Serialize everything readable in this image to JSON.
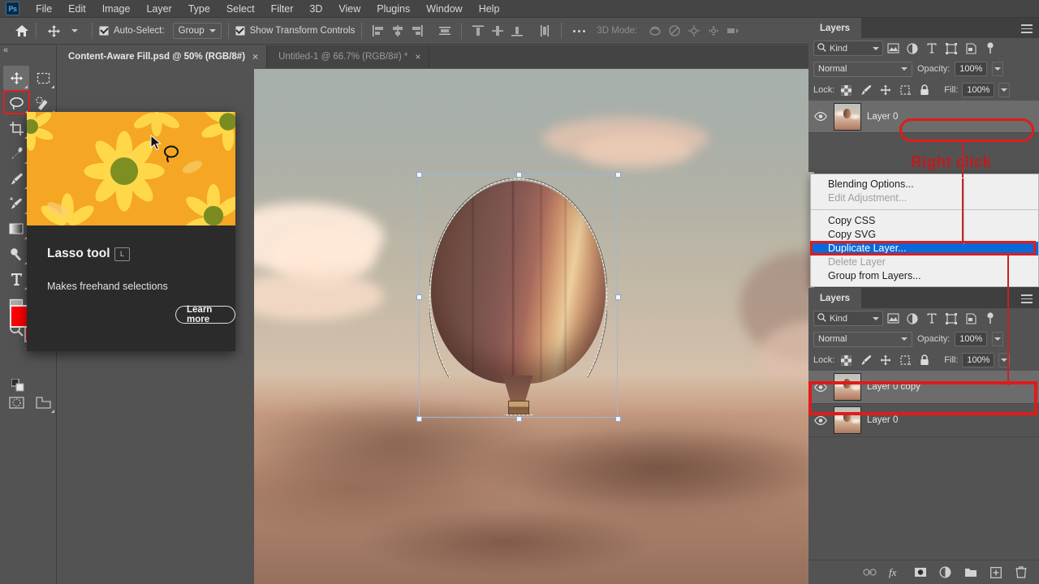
{
  "app": {
    "name": "Adobe Photoshop",
    "logo_text": "Ps"
  },
  "menubar": {
    "items": [
      "File",
      "Edit",
      "Image",
      "Layer",
      "Type",
      "Select",
      "Filter",
      "3D",
      "View",
      "Plugins",
      "Window",
      "Help"
    ]
  },
  "options_bar": {
    "home_icon": "home-icon",
    "active_tool_icon": "move-tool-icon",
    "auto_select_label": "Auto-Select:",
    "auto_select_checked": true,
    "group_value": "Group",
    "show_transform_label": "Show Transform Controls",
    "show_transform_checked": true,
    "align_icons": [
      "align-left-edges-icon",
      "align-horizontal-centers-icon",
      "align-right-edges-icon",
      "distribute-horizontal-icon"
    ],
    "vertical_align_icons": [
      "align-top-edges-icon",
      "align-vertical-centers-icon",
      "align-bottom-edges-icon",
      "distribute-vertical-icon"
    ],
    "more_label": "...",
    "threed_mode_label": "3D Mode:",
    "threed_icons": [
      "rotate-3d-icon",
      "roll-3d-icon",
      "drag-3d-icon",
      "slide-3d-icon",
      "scale-3d-icon"
    ]
  },
  "document_tabs": [
    {
      "label": "Content-Aware Fill.psd @ 50% (RGB/8#)",
      "active": true,
      "close": "×"
    },
    {
      "label": "Untitled-1 @ 66.7% (RGB/8#) *",
      "active": false,
      "close": "×"
    }
  ],
  "toolbar": {
    "collapse_icon": "collapse-panel-icon",
    "tools": [
      {
        "name": "move-tool",
        "col": 0,
        "row": 0,
        "selected": true
      },
      {
        "name": "rectangular-marquee-tool",
        "col": 1,
        "row": 0,
        "selected": false
      },
      {
        "name": "lasso-tool",
        "col": 0,
        "row": 1,
        "selected": false,
        "highlighted": true
      },
      {
        "name": "quick-selection-tool",
        "col": 1,
        "row": 1,
        "selected": false
      },
      {
        "name": "crop-tool",
        "col": 0,
        "row": 2,
        "selected": false
      },
      {
        "name": "eyedropper-tool",
        "col": 0,
        "row": 3,
        "selected": false
      },
      {
        "name": "brush-tool",
        "col": 0,
        "row": 4,
        "selected": false
      },
      {
        "name": "healing-brush-tool",
        "col": 0,
        "row": 5,
        "selected": false
      },
      {
        "name": "gradient-tool",
        "col": 0,
        "row": 6,
        "selected": false
      },
      {
        "name": "dodge-tool",
        "col": 0,
        "row": 7,
        "selected": false
      },
      {
        "name": "type-tool",
        "col": 0,
        "row": 8,
        "selected": false
      },
      {
        "name": "rectangle-tool",
        "col": 0,
        "row": 9,
        "selected": false
      },
      {
        "name": "zoom-tool",
        "col": 0,
        "row": 10,
        "selected": false
      },
      {
        "name": "edit-in-quick-mask-tool",
        "col": 0,
        "row": 12,
        "selected": false
      },
      {
        "name": "screen-mode-tool",
        "col": 1,
        "row": 12,
        "selected": false
      }
    ],
    "foreground_color": "#fe0000",
    "background_color": "#fe0000"
  },
  "tooltip": {
    "title": "Lasso tool",
    "shortcut": "L",
    "description": "Makes freehand selections",
    "button_label": "Learn more",
    "cursor_icon": "arrow-cursor-icon",
    "tool_icon": "lasso-icon"
  },
  "canvas": {
    "subject": "hot-air-balloon",
    "selection_active": true,
    "transform_box": true
  },
  "layers_panel_top": {
    "tab_label": "Layers",
    "menu_icon": "panel-menu-icon",
    "filter_label": "Kind",
    "filter_icons": [
      "filter-pixel-icon",
      "filter-adjustment-icon",
      "filter-type-icon",
      "filter-shape-icon",
      "filter-smartobject-icon",
      "filter-toggle-icon"
    ],
    "blend_mode": "Normal",
    "opacity_label": "Opacity:",
    "opacity_value": "100%",
    "lock_label": "Lock:",
    "lock_icons": [
      "lock-transparency-icon",
      "lock-image-icon",
      "lock-position-icon",
      "lock-artboard-icon",
      "lock-all-icon"
    ],
    "fill_label": "Fill:",
    "fill_value": "100%",
    "layers": [
      {
        "name": "Layer 0",
        "visible": true,
        "selected": true
      }
    ]
  },
  "context_menu": {
    "items": [
      {
        "label": "Blending Options...",
        "state": "normal"
      },
      {
        "label": "Edit Adjustment...",
        "state": "disabled"
      },
      {
        "label": "---",
        "state": "separator"
      },
      {
        "label": "Copy CSS",
        "state": "normal"
      },
      {
        "label": "Copy SVG",
        "state": "normal"
      },
      {
        "label": "Duplicate Layer...",
        "state": "highlighted"
      },
      {
        "label": "Delete Layer",
        "state": "disabled"
      },
      {
        "label": "Group from Layers...",
        "state": "normal"
      }
    ]
  },
  "layers_panel_bottom": {
    "tab_label": "Layers",
    "menu_icon": "panel-menu-icon",
    "filter_label": "Kind",
    "blend_mode": "Normal",
    "opacity_label": "Opacity:",
    "opacity_value": "100%",
    "lock_label": "Lock:",
    "fill_label": "Fill:",
    "fill_value": "100%",
    "layers": [
      {
        "name": "Layer 0 copy",
        "visible": true,
        "selected": true
      },
      {
        "name": "Layer 0",
        "visible": true,
        "selected": false
      }
    ],
    "footer_icons": [
      "link-layers-icon",
      "layer-style-fx-icon",
      "add-layer-mask-icon",
      "new-adjustment-layer-icon",
      "new-group-icon",
      "new-layer-icon",
      "delete-layer-icon"
    ]
  },
  "annotations": {
    "right_click_text": "Right click",
    "color": "#e01b1b",
    "highlight_layer_row": "Layer 0",
    "highlight_menu_item": "Duplicate Layer...",
    "highlight_result_row": "Layer 0 copy"
  }
}
